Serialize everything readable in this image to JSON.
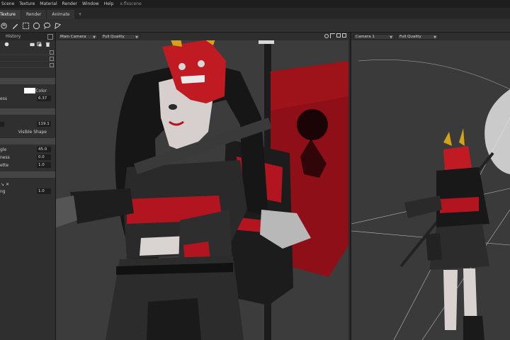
{
  "menu": {
    "items": [
      "Scene",
      "Texture",
      "Material",
      "Render",
      "Window",
      "Help"
    ],
    "doc_title": "x.flxscene"
  },
  "tabs": [
    {
      "label": "Texture",
      "active": true
    },
    {
      "label": "Render",
      "active": false
    },
    {
      "label": "Animate",
      "active": false
    },
    {
      "label": "+",
      "active": false
    }
  ],
  "toolbar": {
    "tools": [
      "paint-icon",
      "pen-icon",
      "rect-select-icon",
      "circle-select-icon",
      "lasso-icon",
      "polygon-lasso-icon"
    ]
  },
  "left_panel": {
    "history_tab": "History",
    "props": {
      "color_label": "Color",
      "color_swatch": "#ffffff",
      "ess_label": "ess",
      "ess_value": "6.37",
      "val1": "119.1",
      "visible_shape": "Visible Shape",
      "gle_label": "gle",
      "gle_value": "45.0",
      "ness_label": "ness",
      "ness_value": "0.0",
      "ette_label": "ette",
      "ette_value": "1.0",
      "ng_label": "ng",
      "ng_value": "1.0"
    }
  },
  "viewport_main": {
    "camera": "Main Camera",
    "quality": "Full Quality"
  },
  "viewport_side": {
    "camera": "Camera 1",
    "quality": "Full Quality"
  },
  "colors": {
    "accent_red": "#b3121f",
    "mask_red": "#c01a22",
    "horn_gold": "#d4a21a",
    "viewport_bg": "#3c3c3c"
  }
}
